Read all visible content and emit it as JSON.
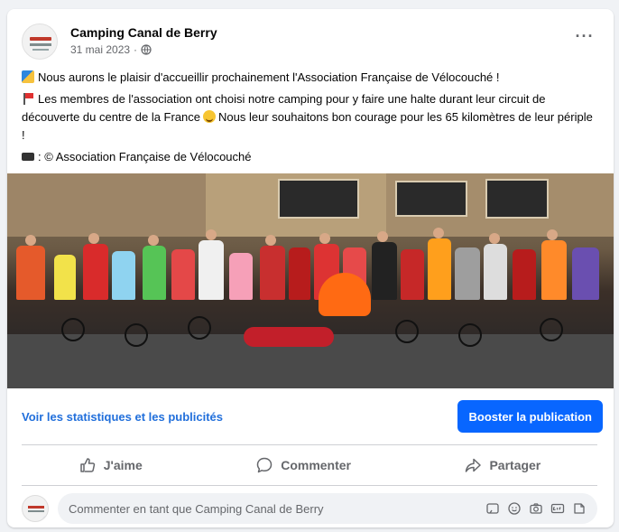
{
  "post": {
    "page_name": "Camping Canal de Berry",
    "date": "31 mai 2023",
    "separator": "·",
    "lines": [
      "Nous aurons le plaisir d'accueillir prochainement l'Association Française de Vélocouché !",
      "Les membres de l'association ont choisi notre camping pour y faire une halte durant leur circuit de découverte du centre de la France",
      "Nous leur souhaitons bon courage pour les 65 kilomètres de leur périple !",
      ": © Association Française de Vélocouché"
    ],
    "more_label": "···"
  },
  "actions": {
    "stats_link": "Voir les statistiques et les publicités",
    "boost_button": "Booster la publication",
    "like": "J'aime",
    "comment": "Commenter",
    "share": "Partager"
  },
  "comment_box": {
    "placeholder": "Commenter en tant que Camping Canal de Berry",
    "icons": [
      "sticker-icon",
      "emoji-icon",
      "camera-icon",
      "gif-icon",
      "sticker-face-icon"
    ]
  },
  "colors": {
    "link": "#216fdb",
    "primary_button": "#0866ff",
    "muted_text": "#65676b"
  }
}
